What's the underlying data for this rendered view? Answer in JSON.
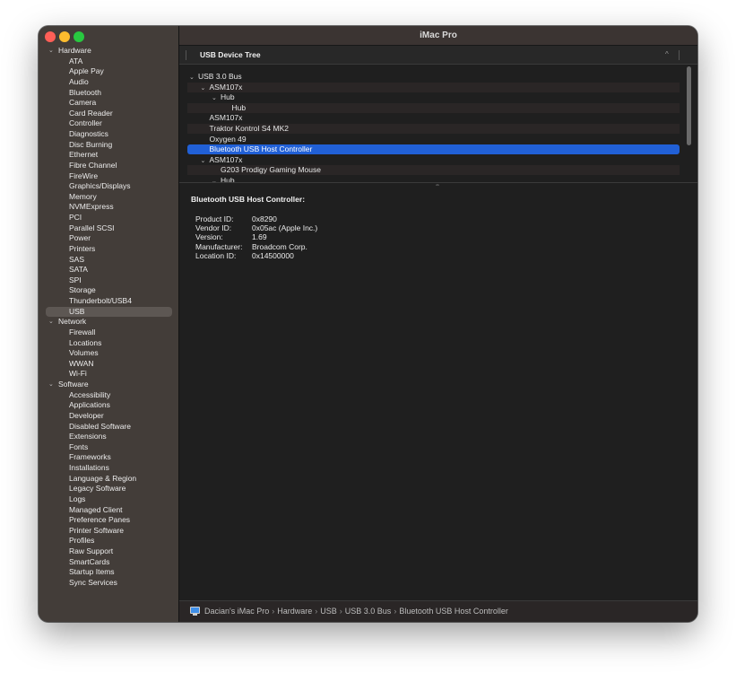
{
  "window": {
    "title": "iMac Pro"
  },
  "sidebar": {
    "groups": [
      {
        "label": "Hardware",
        "items": [
          "ATA",
          "Apple Pay",
          "Audio",
          "Bluetooth",
          "Camera",
          "Card Reader",
          "Controller",
          "Diagnostics",
          "Disc Burning",
          "Ethernet",
          "Fibre Channel",
          "FireWire",
          "Graphics/Displays",
          "Memory",
          "NVMExpress",
          "PCI",
          "Parallel SCSI",
          "Power",
          "Printers",
          "SAS",
          "SATA",
          "SPI",
          "Storage",
          "Thunderbolt/USB4",
          "USB"
        ]
      },
      {
        "label": "Network",
        "items": [
          "Firewall",
          "Locations",
          "Volumes",
          "WWAN",
          "Wi-Fi"
        ]
      },
      {
        "label": "Software",
        "items": [
          "Accessibility",
          "Applications",
          "Developer",
          "Disabled Software",
          "Extensions",
          "Fonts",
          "Frameworks",
          "Installations",
          "Language & Region",
          "Legacy Software",
          "Logs",
          "Managed Client",
          "Preference Panes",
          "Printer Software",
          "Profiles",
          "Raw Support",
          "SmartCards",
          "Startup Items",
          "Sync Services"
        ]
      }
    ],
    "selected": "USB"
  },
  "device_tree": {
    "header": "USB Device Tree",
    "rows": [
      {
        "label": "USB 3.0 Bus",
        "level": 0,
        "expanded": true,
        "selected": false
      },
      {
        "label": "ASM107x",
        "level": 1,
        "expanded": true,
        "selected": false
      },
      {
        "label": "Hub",
        "level": 2,
        "expanded": true,
        "selected": false
      },
      {
        "label": "Hub",
        "level": 3,
        "selected": false
      },
      {
        "label": "ASM107x",
        "level": 1,
        "selected": false
      },
      {
        "label": "Traktor Kontrol S4 MK2",
        "level": 1,
        "selected": false
      },
      {
        "label": "Oxygen 49",
        "level": 1,
        "selected": false
      },
      {
        "label": "Bluetooth USB Host Controller",
        "level": 1,
        "selected": true
      },
      {
        "label": "ASM107x",
        "level": 1,
        "expanded": true,
        "selected": false
      },
      {
        "label": "G203 Prodigy Gaming Mouse",
        "level": 2,
        "selected": false
      },
      {
        "label": "Hub",
        "level": 2,
        "expanded": true,
        "selected": false
      }
    ]
  },
  "detail": {
    "title": "Bluetooth USB Host Controller:",
    "properties": [
      {
        "key": "Product ID:",
        "value": "0x8290"
      },
      {
        "key": "Vendor ID:",
        "value": "0x05ac (Apple Inc.)"
      },
      {
        "key": "Version:",
        "value": "1.69"
      },
      {
        "key": "Manufacturer:",
        "value": "Broadcom Corp."
      },
      {
        "key": "Location ID:",
        "value": "0x14500000"
      }
    ]
  },
  "pathbar": {
    "icon": "imac-icon",
    "crumbs": [
      "Dacian's iMac Pro",
      "Hardware",
      "USB",
      "USB 3.0 Bus",
      "Bluetooth USB Host Controller"
    ],
    "separator": "›"
  },
  "colors": {
    "selection": "#2160d6",
    "sidebar_bg": "#433d39",
    "sidebar_selected": "#5d5753",
    "main_bg": "#1f1f1f"
  }
}
